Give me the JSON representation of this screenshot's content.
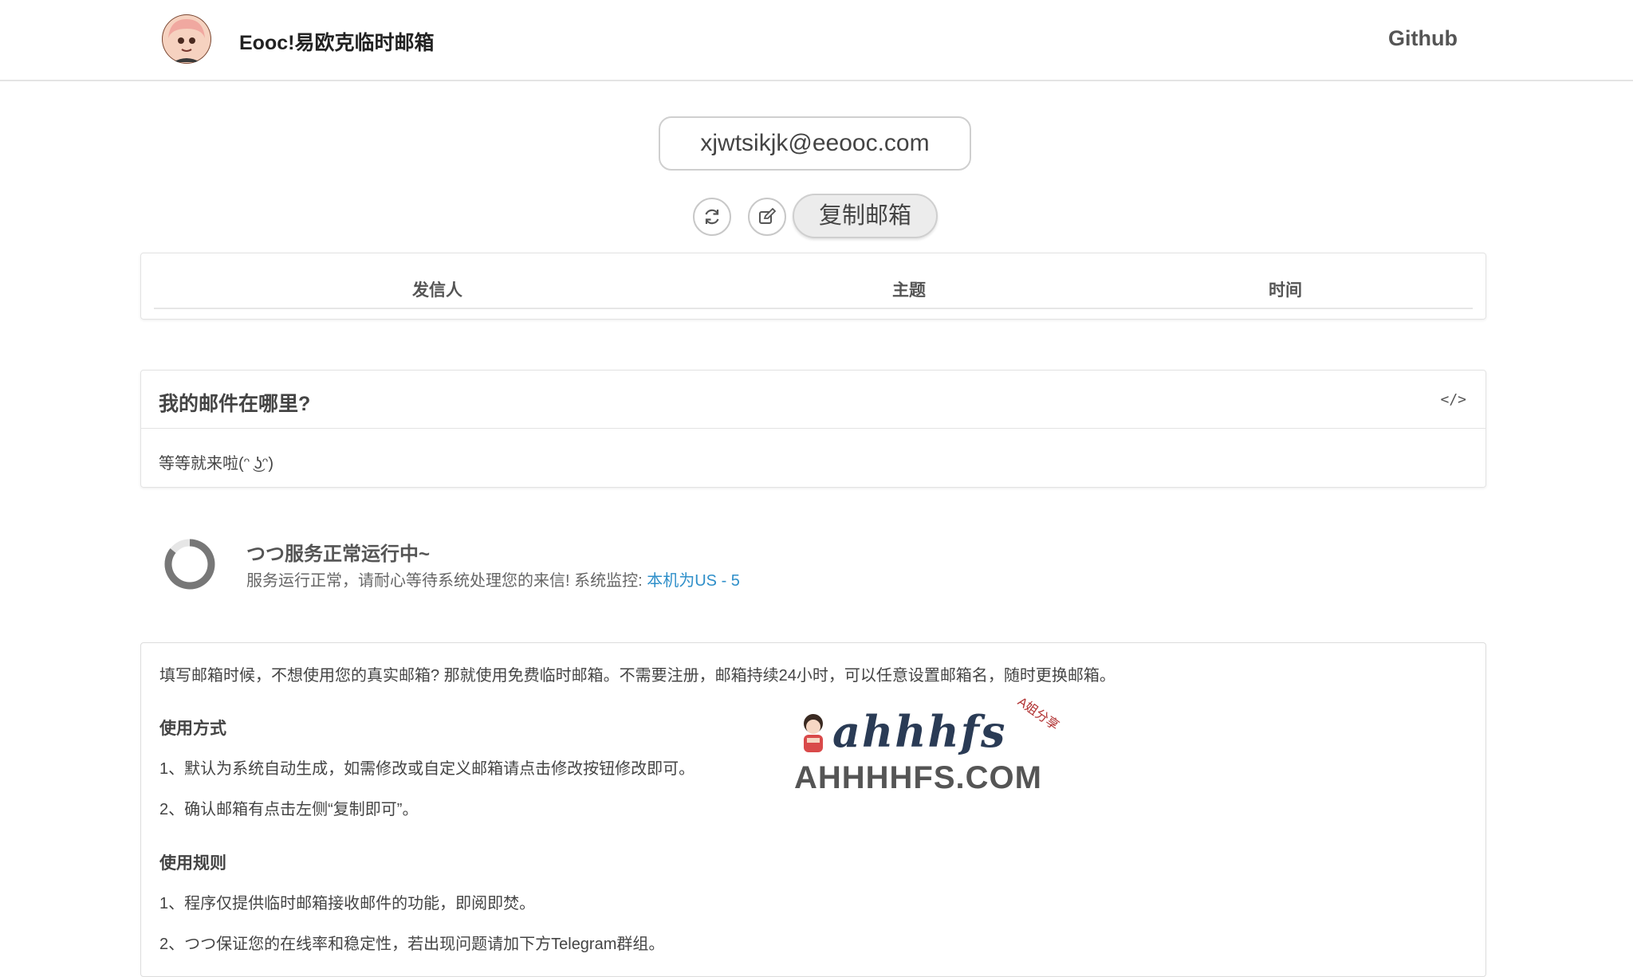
{
  "header": {
    "site_title": "Eooc!易欧克临时邮箱",
    "github_label": "Github"
  },
  "mailbox": {
    "email": "xjwtsikjk@eeooc.com",
    "copy_label": "复制邮箱"
  },
  "mail_table": {
    "columns": [
      "发信人",
      "主题",
      "时间"
    ]
  },
  "panel": {
    "title": "我的邮件在哪里?",
    "body": "等等就来啦(ᵔ ͜ʖᵔ)"
  },
  "status": {
    "title": "つつ服务正常运行中~",
    "description": "服务运行正常，请耐心等待系统处理您的来信! 系统监控: ",
    "link_label": "本机为US - 5"
  },
  "info": {
    "intro": "填写邮箱时候，不想使用您的真实邮箱? 那就使用免费临时邮箱。不需要注册，邮箱持续24小时，可以任意设置邮箱名，随时更换邮箱。",
    "usage_heading": "使用方式",
    "usage_items": [
      "1、默认为系统自动生成，如需修改或自定义邮箱请点击修改按钮修改即可。",
      "2、确认邮箱有点击左侧“复制即可”。"
    ],
    "rules_heading": "使用规则",
    "rules_items": [
      "1、程序仅提供临时邮箱接收邮件的功能，即阅即焚。",
      "2、つつ保证您的在线率和稳定性，若出现问题请加下方Telegram群组。"
    ]
  },
  "watermark": {
    "script": "ahhhfs",
    "tag": "A姐分享",
    "domain": "AHHHHFS.COM"
  },
  "icons": [
    "avatar",
    "refresh-icon",
    "edit-icon",
    "code-icon",
    "spinner-icon"
  ],
  "colors": {
    "link": "#2f8fc9",
    "border": "#e3e3e3",
    "button_bg": "#ececec"
  }
}
